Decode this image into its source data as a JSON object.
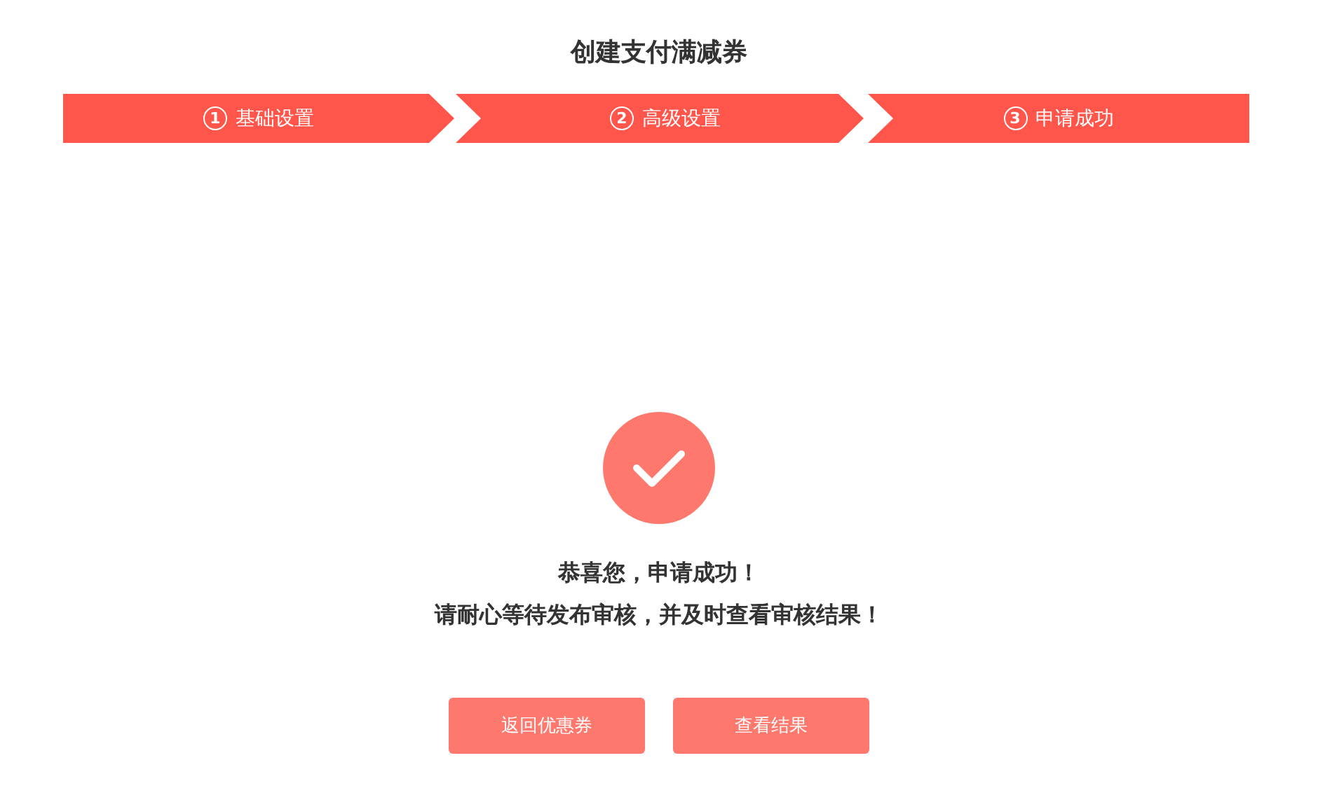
{
  "title": "创建支付满减券",
  "steps": [
    {
      "number": "1",
      "label": "基础设置"
    },
    {
      "number": "2",
      "label": "高级设置"
    },
    {
      "number": "3",
      "label": "申请成功"
    }
  ],
  "result": {
    "lines": [
      "恭喜您，申请成功！",
      "请耐心等待发布审核，并及时查看审核结果！"
    ]
  },
  "buttons": [
    "返回优惠券",
    "查看结果"
  ]
}
